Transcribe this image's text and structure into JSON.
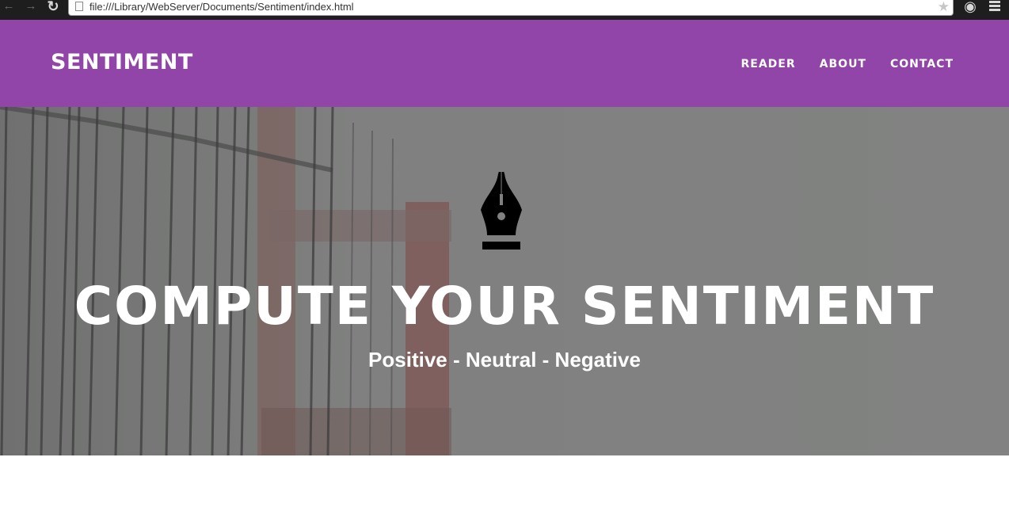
{
  "browser": {
    "url": "file:///Library/WebServer/Documents/Sentiment/index.html"
  },
  "header": {
    "brand": "SENTIMENT",
    "nav": [
      "READER",
      "ABOUT",
      "CONTACT"
    ],
    "background_color": "#9245a8"
  },
  "hero": {
    "icon": "fountain-pen-icon",
    "title": "COMPUTE YOUR SENTIMENT",
    "subtitle": "Positive - Neutral - Negative"
  }
}
